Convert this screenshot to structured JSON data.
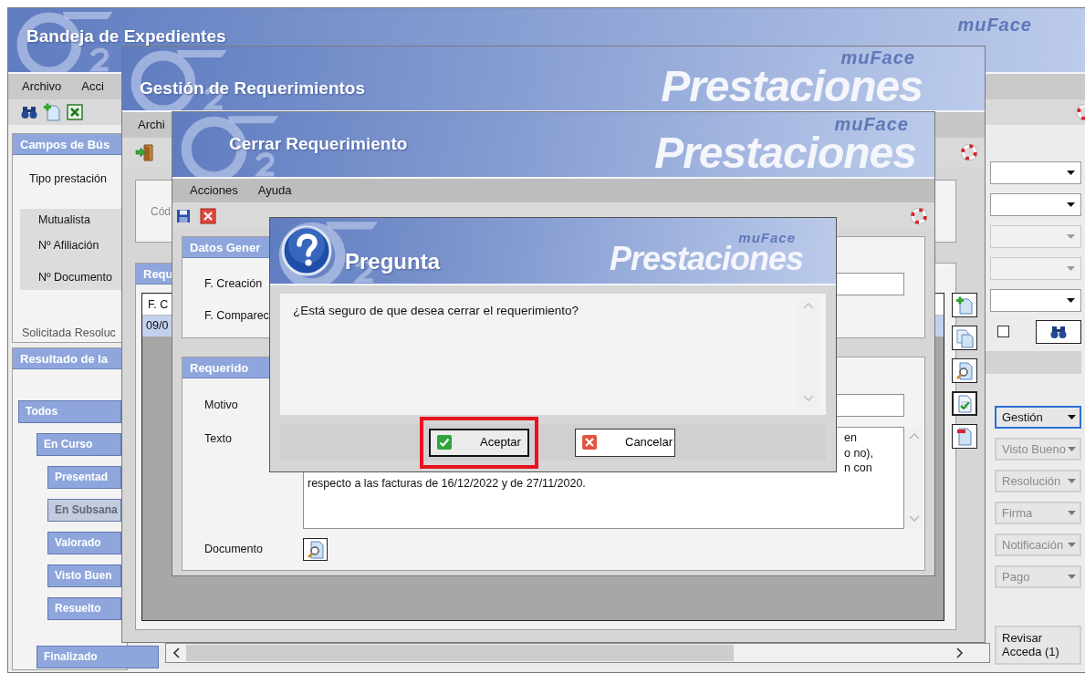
{
  "main_window": {
    "title": "Bandeja de Expedientes",
    "logo_sub": "muFace",
    "menu": [
      "Archivo",
      "Acci"
    ],
    "search": {
      "header": "Campos de Bús",
      "tipo_label": "Tipo prestación",
      "mutualista_labels": [
        "Mutualista",
        "Nº Afiliación",
        "Nº Documento"
      ],
      "resolution_label": "Solicitada Resoluc"
    },
    "combos": [
      {
        "disabled": false
      },
      {
        "disabled": false
      },
      {
        "disabled": true
      },
      {
        "disabled": true
      },
      {
        "disabled": false
      }
    ],
    "filter_checkbox": {
      "checked": false
    },
    "results": {
      "header": "Resultado de la",
      "tree": [
        {
          "label": "Todos",
          "disabled": false,
          "children": [
            {
              "label": "En Curso",
              "disabled": false,
              "children": [
                {
                  "label": "Presentad",
                  "disabled": false
                },
                {
                  "label": "En Subsana",
                  "disabled": true
                },
                {
                  "label": "Valorado",
                  "disabled": false
                },
                {
                  "label": "Visto Buen",
                  "disabled": false
                },
                {
                  "label": "Resuelto",
                  "disabled": false
                }
              ]
            },
            {
              "label": "Finalizado",
              "disabled": false
            }
          ]
        }
      ]
    },
    "actions": [
      {
        "label": "Gestión",
        "disabled": false
      },
      {
        "label": "Visto Bueno",
        "disabled": true
      },
      {
        "label": "Resolución",
        "disabled": true
      },
      {
        "label": "Firma",
        "disabled": true
      },
      {
        "label": "Notificación",
        "disabled": true
      },
      {
        "label": "Pago",
        "disabled": true
      }
    ],
    "review_button": "Revisar Acceda (1)"
  },
  "requirements_window": {
    "title": "Gestión de Requerimientos",
    "logo": "Prestaciones",
    "logo_sub": "muFace",
    "menu": [
      "Archi"
    ],
    "code_label": "Cód",
    "panel_header": "Requ",
    "grid": {
      "column_1": "F. C",
      "rows": [
        {
          "cells": [
            "09/0"
          ],
          "selected": true
        }
      ]
    }
  },
  "close_window": {
    "title": "Cerrar Requerimiento",
    "logo": "Prestaciones",
    "logo_sub": "muFace",
    "menu": [
      "Acciones",
      "Ayuda"
    ],
    "general": {
      "header": "Datos Gener",
      "fields": [
        {
          "label": "F. Creación",
          "kind": "input"
        },
        {
          "label": "F. Comparec",
          "kind": "label"
        }
      ]
    },
    "required": {
      "header": "Requerido",
      "motivo_label": "Motivo",
      "texto_label": "Texto",
      "text_lines": [
        {
          "text": "en",
          "partial": true
        },
        {
          "text": "o no),",
          "partial": true
        },
        {
          "text": "n con",
          "partial": true
        },
        {
          "text": "respecto a las facturas de 16/12/2022 y de 27/11/2020.",
          "partial": false
        }
      ],
      "documento_label": "Documento"
    }
  },
  "question_dialog": {
    "title": "Pregunta",
    "logo": "Prestaciones",
    "logo_sub": "muFace",
    "message": "¿Está seguro de que desea cerrar el requerimiento?",
    "buttons": [
      {
        "label": "Aceptar",
        "kind": "ok",
        "highlighted": true
      },
      {
        "label": "Cancelar",
        "kind": "cancel",
        "highlighted": false
      }
    ]
  }
}
